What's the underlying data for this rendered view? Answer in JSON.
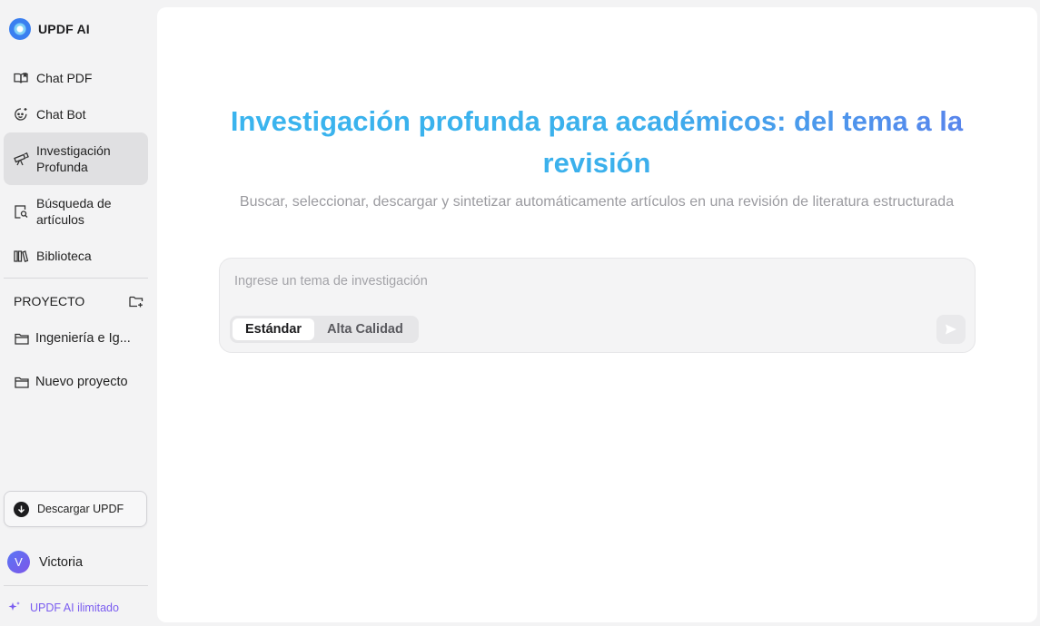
{
  "app": {
    "name": "UPDF AI"
  },
  "sidebar": {
    "items": [
      {
        "label": "Chat PDF",
        "icon": "book-open-icon"
      },
      {
        "label": "Chat Bot",
        "icon": "chat-bot-icon"
      },
      {
        "label": "Investigación Profunda",
        "icon": "telescope-icon",
        "active": true
      },
      {
        "label": "Búsqueda de artículos",
        "icon": "document-search-icon"
      },
      {
        "label": "Biblioteca",
        "icon": "library-icon"
      }
    ],
    "project_section": {
      "title": "PROYECTO",
      "add_icon": "folder-add-icon",
      "items": [
        {
          "label": "Ingeniería e Ig...",
          "icon": "folder-icon"
        },
        {
          "label": "Nuevo proyecto",
          "icon": "folder-icon"
        }
      ]
    },
    "download_button": {
      "label": "Descargar UPDF",
      "icon": "download-icon"
    },
    "user": {
      "name": "Victoria",
      "initial": "V"
    },
    "upgrade": {
      "label": "UPDF AI ilimitado",
      "icon": "sparkle-icon"
    }
  },
  "main": {
    "headline": "Investigación profunda para académicos: del tema a la revisión",
    "subtitle": "Buscar, seleccionar, descargar y sintetizar automáticamente artículos en una revisión de literatura estructurada",
    "input": {
      "placeholder": "Ingrese un tema de investigación",
      "value": ""
    },
    "modes": [
      {
        "label": "Estándar",
        "selected": true
      },
      {
        "label": "Alta Calidad",
        "selected": false
      }
    ],
    "send_icon": "send-icon"
  },
  "colors": {
    "accent_gradient_start": "#3ab4ee",
    "accent_gradient_end": "#5a83ec",
    "active_nav_bg": "#e0e0e2",
    "upgrade_text": "#7a5cf0"
  }
}
